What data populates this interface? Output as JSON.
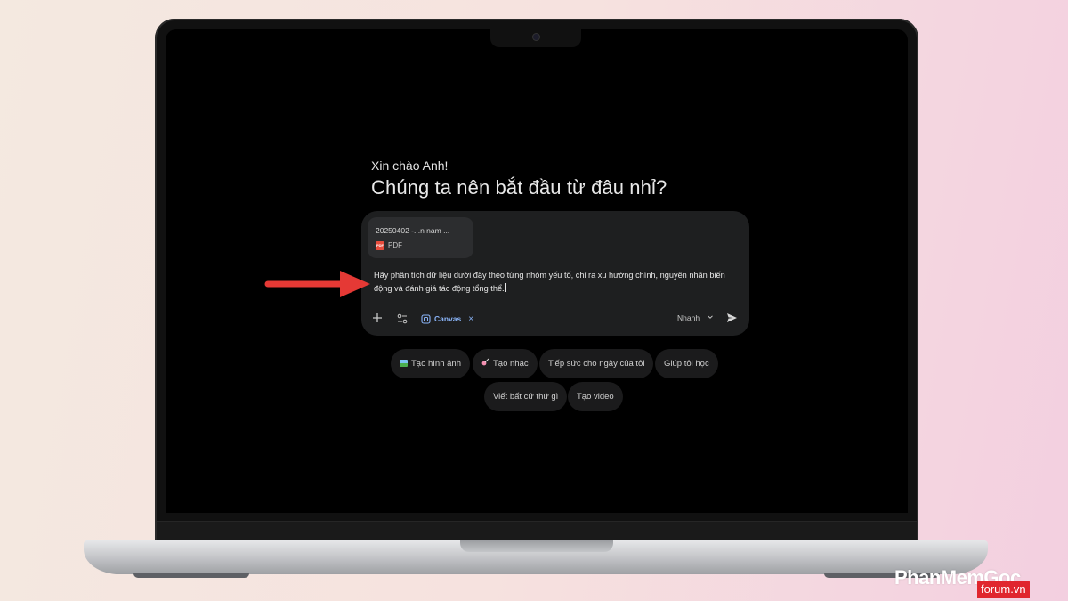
{
  "greeting": "Xin chào Anh!",
  "headline": "Chúng ta nên bắt đầu từ đâu nhỉ?",
  "attachment": {
    "name": "20250402 -...n nam ...",
    "type": "PDF",
    "icon": "pdf-file-icon"
  },
  "prompt": {
    "text": "Hãy phân tích dữ liệu dưới đây theo từng nhóm yếu tố, chỉ ra xu hướng chính, nguyên nhân biến động và đánh giá tác động tổng thể."
  },
  "toolbar": {
    "add_icon": "plus-icon",
    "tools_icon": "tools-sliders-icon",
    "canvas_label": "Canvas",
    "canvas_remove_icon": "close-icon",
    "model_label": "Nhanh",
    "send_icon": "send-icon"
  },
  "suggestions": [
    {
      "label": "Tạo hình ảnh",
      "icon": "image-icon"
    },
    {
      "label": "Tạo nhạc",
      "icon": "guitar-icon"
    },
    {
      "label": "Tiếp sức cho ngày của tôi"
    },
    {
      "label": "Giúp tôi học"
    },
    {
      "label": "Viết bất cứ thứ gì"
    },
    {
      "label": "Tạo video"
    }
  ],
  "watermark": {
    "brand": "PhanMemGoc",
    "badge": "forum.vn"
  },
  "colors": {
    "accent": "#8ab4f8",
    "arrow": "#e53935",
    "composer_bg": "#1e1f20"
  }
}
